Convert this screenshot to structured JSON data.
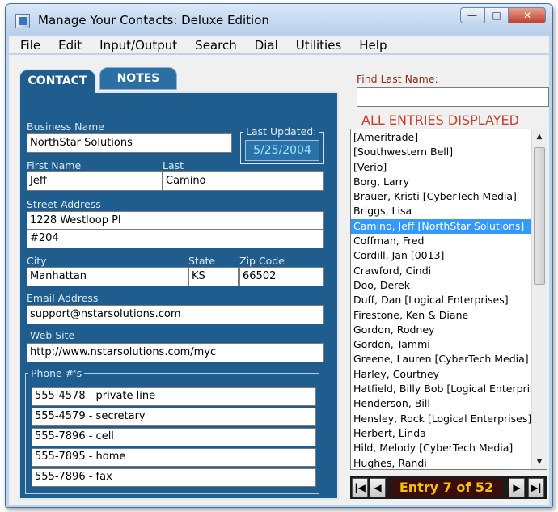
{
  "window": {
    "title": "Manage Your Contacts: Deluxe Edition",
    "minimize_glyph": "—",
    "maximize_glyph": "□",
    "close_glyph": "✕"
  },
  "menu": [
    "File",
    "Edit",
    "Input/Output",
    "Search",
    "Dial",
    "Utilities",
    "Help"
  ],
  "tabs": {
    "contact": "CONTACT",
    "notes": "NOTES"
  },
  "contact": {
    "business_name_label": "Business Name",
    "business_name": "NorthStar Solutions",
    "last_updated_label": "Last Updated:",
    "last_updated": "5/25/2004",
    "first_name_label": "First Name",
    "first_name": "Jeff",
    "last_label": "Last",
    "last_name": "Camino",
    "street_label": "Street Address",
    "street1": "1228 Westloop Pl",
    "street2": "#204",
    "city_label": "City",
    "city": "Manhattan",
    "state_label": "State",
    "state": "KS",
    "zip_label": "Zip Code",
    "zip": "66502",
    "email_label": "Email Address",
    "email": "support@nstarsolutions.com",
    "web_label": "Web Site",
    "web": "http://www.nstarsolutions.com/myc",
    "phones_label": "Phone #'s",
    "phones": [
      "555-4578  - private line",
      "555-4579  - secretary",
      "555-7896  - cell",
      "555-7895  - home",
      "555-7896  - fax"
    ]
  },
  "search": {
    "find_label": "Find Last Name:",
    "value": ""
  },
  "list": {
    "header": "ALL ENTRIES DISPLAYED",
    "selected_index": 6,
    "items": [
      "[Ameritrade]",
      "[Southwestern Bell]",
      "[Verio]",
      "Borg, Larry",
      "Brauer, Kristi [CyberTech Media]",
      "Briggs, Lisa",
      "Camino, Jeff [NorthStar Solutions]",
      "Coffman, Fred",
      "Cordill, Jan [0013]",
      "Crawford, Cindi",
      "Doo, Derek",
      "Duff, Dan [Logical Enterprises]",
      "Firestone, Ken & Diane",
      "Gordon, Rodney",
      "Gordon, Tammi",
      "Greene, Lauren [CyberTech Media]",
      "Harley, Courtney",
      "Hatfield, Billy Bob [Logical Enterprises]",
      "Henderson, Bill",
      "Hensley, Rock [Logical Enterprises]",
      "Herbert, Linda",
      "Hild, Melody [CyberTech Media]",
      "Hughes, Randi"
    ]
  },
  "navigator": {
    "entry_text": "Entry 7 of 52",
    "first_glyph": "|◀",
    "prev_glyph": "◀",
    "next_glyph": "▶",
    "last_glyph": "▶|"
  },
  "icons": {
    "app": "contacts-app-icon",
    "scroll_up": "▲",
    "scroll_down": "▼"
  }
}
